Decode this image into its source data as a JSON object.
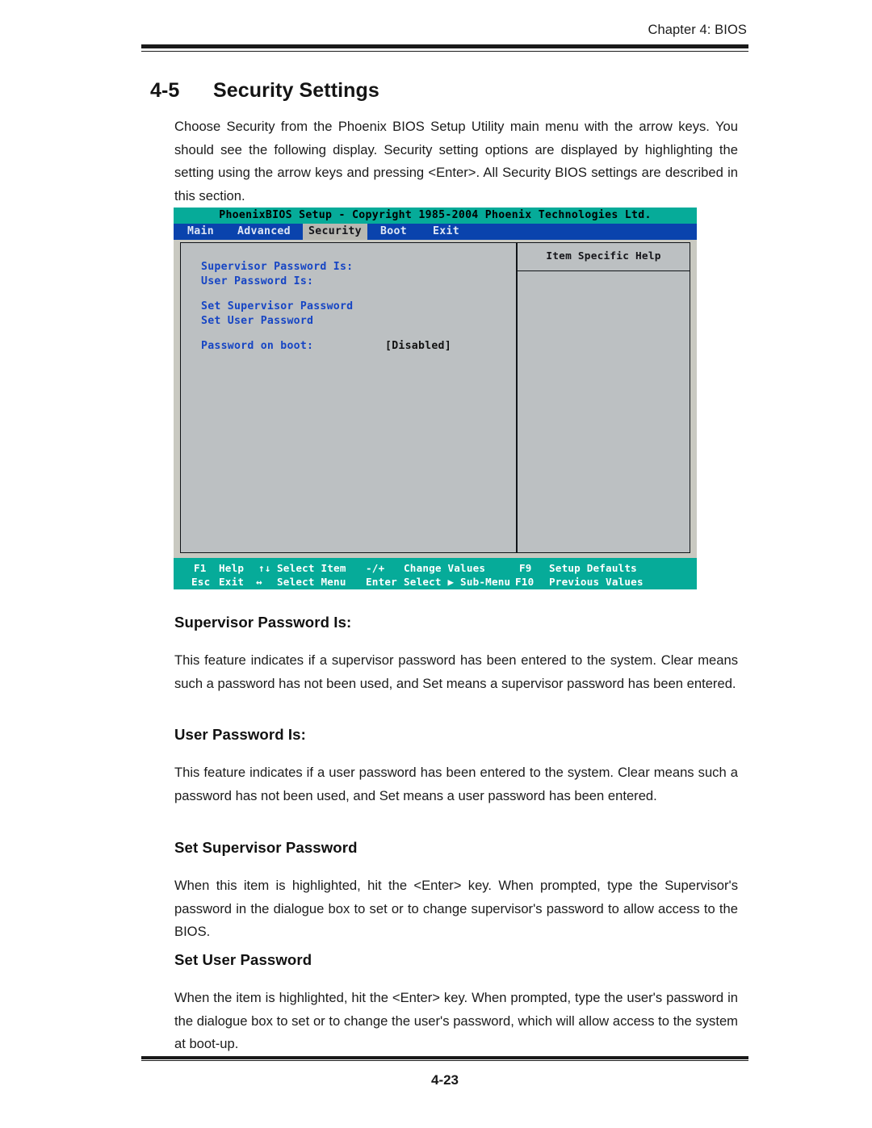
{
  "header": {
    "chapter": "Chapter 4: BIOS"
  },
  "section": {
    "number": "4-5",
    "title": "Security Settings"
  },
  "intro": "Choose Security from the Phoenix BIOS Setup Utility main menu with the arrow keys.  You should see the following display.  Security setting options are displayed by highlighting the setting using the arrow keys and pressing <Enter>.  All Security BIOS settings are described in this section.",
  "bios": {
    "title": "PhoenixBIOS Setup - Copyright 1985-2004 Phoenix Technologies Ltd.",
    "menu": [
      {
        "label": "Main",
        "selected": false
      },
      {
        "label": "Advanced",
        "selected": false
      },
      {
        "label": "Security",
        "selected": true
      },
      {
        "label": "Boot",
        "selected": false
      },
      {
        "label": "Exit",
        "selected": false
      }
    ],
    "help_title": "Item Specific Help",
    "rows": [
      {
        "label": "Supervisor Password Is:",
        "value": ""
      },
      {
        "label": "User Password Is:",
        "value": ""
      },
      {
        "label": "Set Supervisor Password",
        "value": ""
      },
      {
        "label": "Set User Password",
        "value": ""
      },
      {
        "label": "Password on boot:",
        "value": "[Disabled]"
      }
    ],
    "footer_keys": [
      {
        "key": "F1",
        "action": "Help"
      },
      {
        "key": "↑↓",
        "action": "Select Item"
      },
      {
        "key": "-/+",
        "action": "Change Values"
      },
      {
        "key": "F9",
        "action": "Setup Defaults"
      },
      {
        "key": "Esc",
        "action": "Exit"
      },
      {
        "key": "↔",
        "action": "Select Menu"
      },
      {
        "key": "Enter",
        "action": "Select ▶ Sub-Menu"
      },
      {
        "key": "F10",
        "action": "Previous Values"
      }
    ],
    "colors": {
      "title_bar": "#06ab99",
      "menu_bar": "#0a43ad",
      "panel": "#bcc0c2",
      "label_blue": "#1645c4",
      "footer_bar": "#06ab99"
    }
  },
  "subsections": [
    {
      "heading": "Supervisor Password Is:",
      "body": "This feature indicates if a supervisor password has been entered to the system.  Clear means such a password has not been used, and Set means a supervisor password has been entered."
    },
    {
      "heading": "User Password Is:",
      "body": "This feature indicates if a user password has been entered to the system.  Clear means such a password has not been used, and Set means a user password has been entered."
    },
    {
      "heading": "Set Supervisor Password",
      "body": "When this item is highlighted, hit the <Enter> key.  When prompted, type the Supervisor's password in the dialogue box to set or to change supervisor's password to allow access to the BIOS."
    },
    {
      "heading": "Set User Password",
      "body": "When the item is highlighted, hit the <Enter> key.  When prompted, type the user's password in the dialogue box to set or to change the user's password, which will allow access to the system at boot-up."
    }
  ],
  "footer": {
    "page_number": "4-23"
  }
}
